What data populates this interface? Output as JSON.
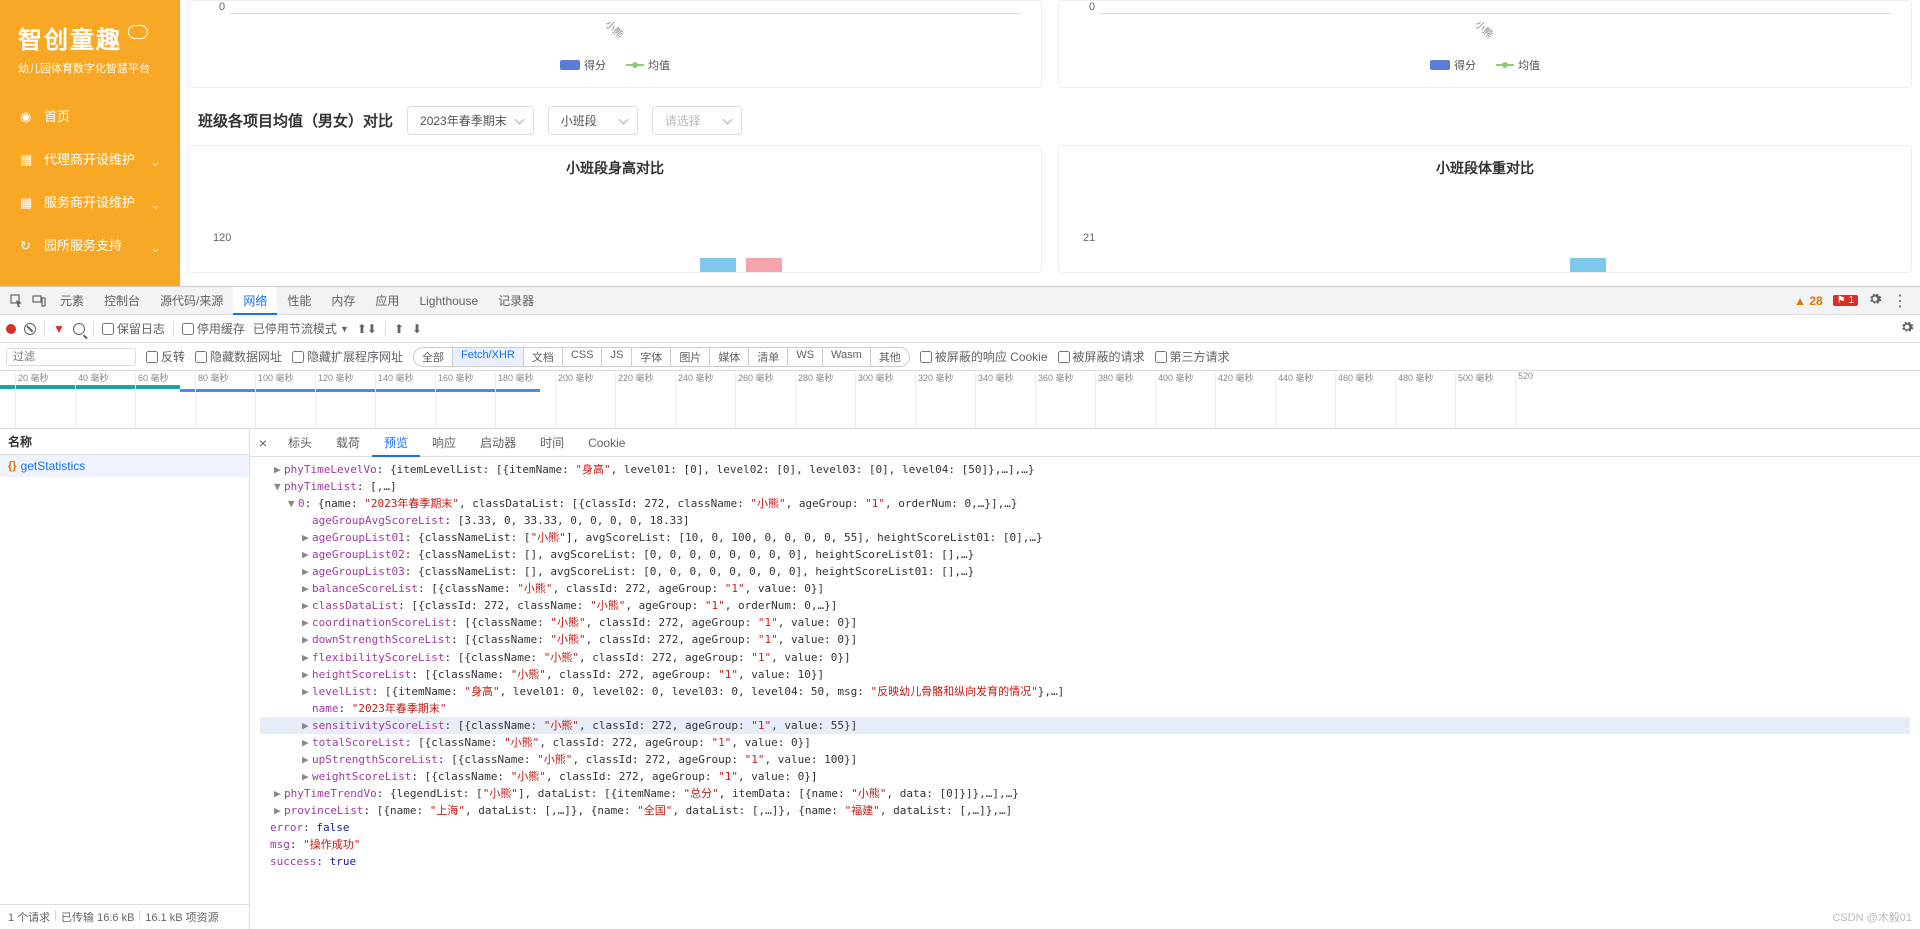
{
  "sidebar": {
    "logo": "智创童趣",
    "subtitle": "幼儿园体育数字化智慧平台",
    "items": [
      {
        "label": "首页",
        "has_children": false
      },
      {
        "label": "代理商开设维护",
        "has_children": true
      },
      {
        "label": "服务商开设维护",
        "has_children": true
      },
      {
        "label": "园所服务支持",
        "has_children": true
      }
    ]
  },
  "charts_top": {
    "left": {
      "y0": "0",
      "xlabel": "小熊",
      "legend1": "得分",
      "legend2": "均值"
    },
    "right": {
      "y0": "0",
      "xlabel": "小熊",
      "legend1": "得分",
      "legend2": "均值"
    }
  },
  "section": {
    "title": "班级各项目均值（男女）对比",
    "select1": "2023年春季期末",
    "select2": "小班段",
    "select3_placeholder": "请选择"
  },
  "charts_row2": {
    "left": {
      "title": "小班段身高对比",
      "yval": "120"
    },
    "right": {
      "title": "小班段体重对比",
      "yval": "21"
    }
  },
  "devtools": {
    "tabs": [
      "元素",
      "控制台",
      "源代码/来源",
      "网络",
      "性能",
      "内存",
      "应用",
      "Lighthouse",
      "记录器"
    ],
    "active_tab": "网络",
    "warn_count": "28",
    "err_count": "1",
    "toolbar": {
      "preserve_log": "保留日志",
      "disable_cache": "停用缓存",
      "throttle": "已停用节流模式"
    },
    "filter": {
      "placeholder": "过滤",
      "invert": "反转",
      "hide_data": "隐藏数据网址",
      "hide_ext": "隐藏扩展程序网址",
      "pills": [
        "全部",
        "Fetch/XHR",
        "文档",
        "CSS",
        "JS",
        "字体",
        "图片",
        "媒体",
        "清单",
        "WS",
        "Wasm",
        "其他"
      ],
      "active_pill": "Fetch/XHR",
      "blocked_cookies": "被屏蔽的响应 Cookie",
      "blocked_req": "被屏蔽的请求",
      "third_party": "第三方请求"
    },
    "timeline": {
      "ticks": [
        "20 毫秒",
        "40 毫秒",
        "60 毫秒",
        "80 毫秒",
        "100 毫秒",
        "120 毫秒",
        "140 毫秒",
        "160 毫秒",
        "180 毫秒",
        "200 毫秒",
        "220 毫秒",
        "240 毫秒",
        "260 毫秒",
        "280 毫秒",
        "300 毫秒",
        "320 毫秒",
        "340 毫秒",
        "360 毫秒",
        "380 毫秒",
        "400 毫秒",
        "420 毫秒",
        "440 毫秒",
        "460 毫秒",
        "480 毫秒",
        "500 毫秒",
        "520"
      ]
    },
    "req_header": "名称",
    "req_item": "getStatistics",
    "req_footer": {
      "count": "1 个请求",
      "transferred": "已传输 16.6 kB",
      "resources": "16.1 kB 项资源"
    },
    "detail_tabs": [
      "标头",
      "载荷",
      "预览",
      "响应",
      "启动器",
      "时间",
      "Cookie"
    ],
    "active_detail_tab": "预览",
    "preview_lines": [
      {
        "indent": 1,
        "tri": "▶",
        "content": [
          {
            "k": "phyTimeLevelVo"
          },
          {
            "p": ": {itemLevelList: [{itemName: "
          },
          {
            "s": "\"身高\""
          },
          {
            "p": ", level01: [0], level02: [0], level03: [0], level04: [50]},…],…}"
          }
        ]
      },
      {
        "indent": 1,
        "tri": "▼",
        "content": [
          {
            "k": "phyTimeList"
          },
          {
            "p": ": [,…]"
          }
        ]
      },
      {
        "indent": 2,
        "tri": "▼",
        "content": [
          {
            "k": "0"
          },
          {
            "p": ": {name: "
          },
          {
            "s": "\"2023年春季期末\""
          },
          {
            "p": ", classDataList: [{classId: 272, className: "
          },
          {
            "s": "\"小熊\""
          },
          {
            "p": ", ageGroup: "
          },
          {
            "s": "\"1\""
          },
          {
            "p": ", orderNum: 0,…}],…}"
          }
        ]
      },
      {
        "indent": 3,
        "tri": "",
        "content": [
          {
            "k": "ageGroupAvgScoreList"
          },
          {
            "p": ": [3.33, 0, 33.33, 0, 0, 0, 0, 18.33]"
          }
        ]
      },
      {
        "indent": 3,
        "tri": "▶",
        "content": [
          {
            "k": "ageGroupList01"
          },
          {
            "p": ": {classNameList: ["
          },
          {
            "s": "\"小熊\""
          },
          {
            "p": "], avgScoreList: [10, 0, 100, 0, 0, 0, 0, 55], heightScoreList01: [0],…}"
          }
        ]
      },
      {
        "indent": 3,
        "tri": "▶",
        "content": [
          {
            "k": "ageGroupList02"
          },
          {
            "p": ": {classNameList: [], avgScoreList: [0, 0, 0, 0, 0, 0, 0, 0], heightScoreList01: [],…}"
          }
        ]
      },
      {
        "indent": 3,
        "tri": "▶",
        "content": [
          {
            "k": "ageGroupList03"
          },
          {
            "p": ": {classNameList: [], avgScoreList: [0, 0, 0, 0, 0, 0, 0, 0], heightScoreList01: [],…}"
          }
        ]
      },
      {
        "indent": 3,
        "tri": "▶",
        "content": [
          {
            "k": "balanceScoreList"
          },
          {
            "p": ": [{className: "
          },
          {
            "s": "\"小熊\""
          },
          {
            "p": ", classId: 272, ageGroup: "
          },
          {
            "s": "\"1\""
          },
          {
            "p": ", value: 0}]"
          }
        ]
      },
      {
        "indent": 3,
        "tri": "▶",
        "content": [
          {
            "k": "classDataList"
          },
          {
            "p": ": [{classId: 272, className: "
          },
          {
            "s": "\"小熊\""
          },
          {
            "p": ", ageGroup: "
          },
          {
            "s": "\"1\""
          },
          {
            "p": ", orderNum: 0,…}]"
          }
        ]
      },
      {
        "indent": 3,
        "tri": "▶",
        "content": [
          {
            "k": "coordinationScoreList"
          },
          {
            "p": ": [{className: "
          },
          {
            "s": "\"小熊\""
          },
          {
            "p": ", classId: 272, ageGroup: "
          },
          {
            "s": "\"1\""
          },
          {
            "p": ", value: 0}]"
          }
        ]
      },
      {
        "indent": 3,
        "tri": "▶",
        "content": [
          {
            "k": "downStrengthScoreList"
          },
          {
            "p": ": [{className: "
          },
          {
            "s": "\"小熊\""
          },
          {
            "p": ", classId: 272, ageGroup: "
          },
          {
            "s": "\"1\""
          },
          {
            "p": ", value: 0}]"
          }
        ]
      },
      {
        "indent": 3,
        "tri": "▶",
        "content": [
          {
            "k": "flexibilityScoreList"
          },
          {
            "p": ": [{className: "
          },
          {
            "s": "\"小熊\""
          },
          {
            "p": ", classId: 272, ageGroup: "
          },
          {
            "s": "\"1\""
          },
          {
            "p": ", value: 0}]"
          }
        ]
      },
      {
        "indent": 3,
        "tri": "▶",
        "content": [
          {
            "k": "heightScoreList"
          },
          {
            "p": ": [{className: "
          },
          {
            "s": "\"小熊\""
          },
          {
            "p": ", classId: 272, ageGroup: "
          },
          {
            "s": "\"1\""
          },
          {
            "p": ", value: 10}]"
          }
        ]
      },
      {
        "indent": 3,
        "tri": "▶",
        "content": [
          {
            "k": "levelList"
          },
          {
            "p": ": [{itemName: "
          },
          {
            "s": "\"身高\""
          },
          {
            "p": ", level01: 0, level02: 0, level03: 0, level04: 50, msg: "
          },
          {
            "s": "\"反映幼儿骨骼和纵向发育的情况\""
          },
          {
            "p": "},…]"
          }
        ]
      },
      {
        "indent": 3,
        "tri": "",
        "content": [
          {
            "k": "name"
          },
          {
            "p": ": "
          },
          {
            "s": "\"2023年春季期末\""
          }
        ]
      },
      {
        "indent": 3,
        "tri": "▶",
        "hl": true,
        "content": [
          {
            "k": "sensitivityScoreList"
          },
          {
            "p": ": [{className: "
          },
          {
            "s": "\"小熊\""
          },
          {
            "p": ", classId: 272, ageGroup: "
          },
          {
            "s": "\"1\""
          },
          {
            "p": ", value: 55}]"
          }
        ]
      },
      {
        "indent": 3,
        "tri": "▶",
        "content": [
          {
            "k": "totalScoreList"
          },
          {
            "p": ": [{className: "
          },
          {
            "s": "\"小熊\""
          },
          {
            "p": ", classId: 272, ageGroup: "
          },
          {
            "s": "\"1\""
          },
          {
            "p": ", value: 0}]"
          }
        ]
      },
      {
        "indent": 3,
        "tri": "▶",
        "content": [
          {
            "k": "upStrengthScoreList"
          },
          {
            "p": ": [{className: "
          },
          {
            "s": "\"小熊\""
          },
          {
            "p": ", classId: 272, ageGroup: "
          },
          {
            "s": "\"1\""
          },
          {
            "p": ", value: 100}]"
          }
        ]
      },
      {
        "indent": 3,
        "tri": "▶",
        "content": [
          {
            "k": "weightScoreList"
          },
          {
            "p": ": [{className: "
          },
          {
            "s": "\"小熊\""
          },
          {
            "p": ", classId: 272, ageGroup: "
          },
          {
            "s": "\"1\""
          },
          {
            "p": ", value: 0}]"
          }
        ]
      },
      {
        "indent": 1,
        "tri": "▶",
        "content": [
          {
            "k": "phyTimeTrendVo"
          },
          {
            "p": ": {legendList: ["
          },
          {
            "s": "\"小熊\""
          },
          {
            "p": "], dataList: [{itemName: "
          },
          {
            "s": "\"总分\""
          },
          {
            "p": ", itemData: [{name: "
          },
          {
            "s": "\"小熊\""
          },
          {
            "p": ", data: [0]}]},…],…}"
          }
        ]
      },
      {
        "indent": 1,
        "tri": "▶",
        "content": [
          {
            "k": "provinceList"
          },
          {
            "p": ": [{name: "
          },
          {
            "s": "\"上海\""
          },
          {
            "p": ", dataList: [,…]}, {name: "
          },
          {
            "s": "\"全国\""
          },
          {
            "p": ", dataList: [,…]}, {name: "
          },
          {
            "s": "\"福建\""
          },
          {
            "p": ", dataList: [,…]},…]"
          }
        ]
      },
      {
        "indent": 0,
        "tri": "",
        "content": [
          {
            "k": "error"
          },
          {
            "p": ": "
          },
          {
            "b": "false"
          }
        ]
      },
      {
        "indent": 0,
        "tri": "",
        "content": [
          {
            "k": "msg"
          },
          {
            "p": ": "
          },
          {
            "s": "\"操作成功\""
          }
        ]
      },
      {
        "indent": 0,
        "tri": "",
        "content": [
          {
            "k": "success"
          },
          {
            "p": ": "
          },
          {
            "b": "true"
          }
        ]
      }
    ]
  },
  "watermark": "CSDN @木毅01"
}
